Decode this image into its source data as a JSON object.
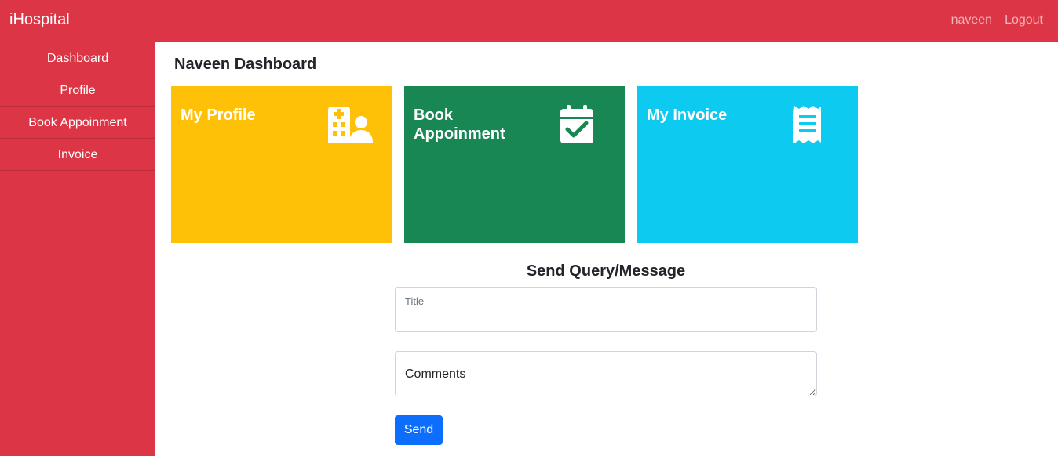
{
  "app": {
    "brand": "iHospital"
  },
  "header": {
    "user": "naveen",
    "logout": "Logout"
  },
  "sidebar": {
    "items": [
      {
        "label": "Dashboard"
      },
      {
        "label": "Profile"
      },
      {
        "label": "Book Appoinment"
      },
      {
        "label": "Invoice"
      }
    ]
  },
  "main": {
    "title": "Naveen Dashboard"
  },
  "cards": [
    {
      "label": "My Profile",
      "color": "#ffc107",
      "icon": "hospital-user-icon"
    },
    {
      "label": "Book Appoinment",
      "color": "#198754",
      "icon": "calendar-check-icon"
    },
    {
      "label": "My Invoice",
      "color": "#0dcaf0",
      "icon": "receipt-icon"
    }
  ],
  "form": {
    "title": "Send Query/Message",
    "title_field": {
      "label": "Title",
      "value": ""
    },
    "comments_field": {
      "placeholder": "Comments",
      "value": ""
    },
    "send_label": "Send"
  },
  "colors": {
    "brand": "#dc3545",
    "primary": "#0d6efd"
  }
}
